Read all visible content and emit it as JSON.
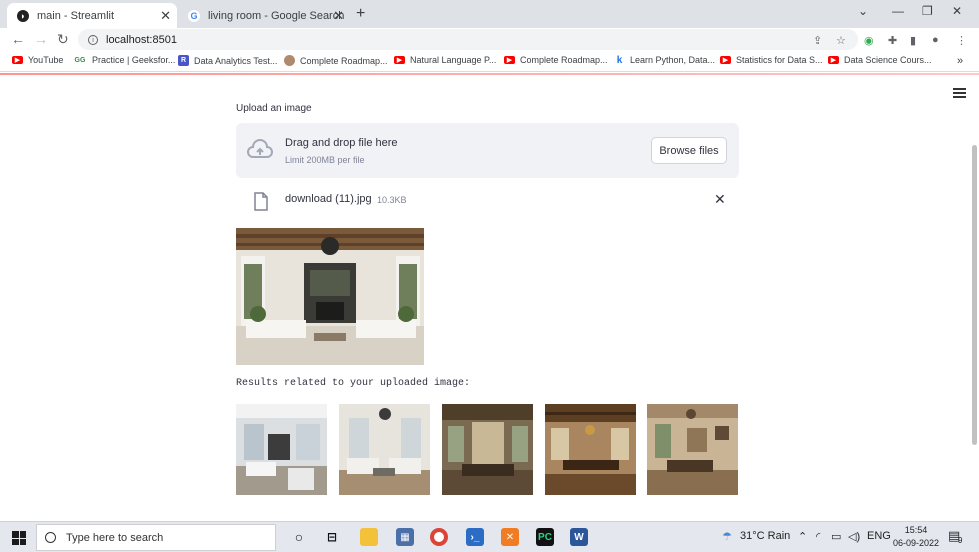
{
  "tabs": [
    {
      "title": "main - Streamlit",
      "active": true
    },
    {
      "title": "living room - Google Search",
      "active": false
    }
  ],
  "address": {
    "url": "localhost:8501"
  },
  "bookmarks": [
    {
      "label": "YouTube",
      "icon": "youtube-icon"
    },
    {
      "label": "Practice | Geeksfor...",
      "icon": "geeksforgeeks-icon"
    },
    {
      "label": "Data Analytics Test...",
      "icon": "r-icon"
    },
    {
      "label": "Complete Roadmap...",
      "icon": "avatar-icon"
    },
    {
      "label": "Natural Language P...",
      "icon": "youtube-icon"
    },
    {
      "label": "Complete Roadmap...",
      "icon": "youtube-icon"
    },
    {
      "label": "Learn Python, Data...",
      "icon": "k-icon"
    },
    {
      "label": "Statistics for Data S...",
      "icon": "youtube-icon"
    },
    {
      "label": "Data Science Cours...",
      "icon": "youtube-icon"
    }
  ],
  "uploader": {
    "label": "Upload an image",
    "drop_title": "Drag and drop file here",
    "limit": "Limit 200MB per file",
    "browse": "Browse files"
  },
  "file": {
    "name": "download (11).jpg",
    "size": "10.3KB"
  },
  "results_text": "Results related to your uploaded image:",
  "taskbar": {
    "search_placeholder": "Type here to search",
    "weather": "31°C  Rain",
    "lang": "ENG",
    "time": "15:54",
    "date": "06-09-2022",
    "notifications": "9"
  },
  "colors": {
    "streamlit_accent": "#ff4b4b",
    "youtube_red": "#ff0000"
  }
}
